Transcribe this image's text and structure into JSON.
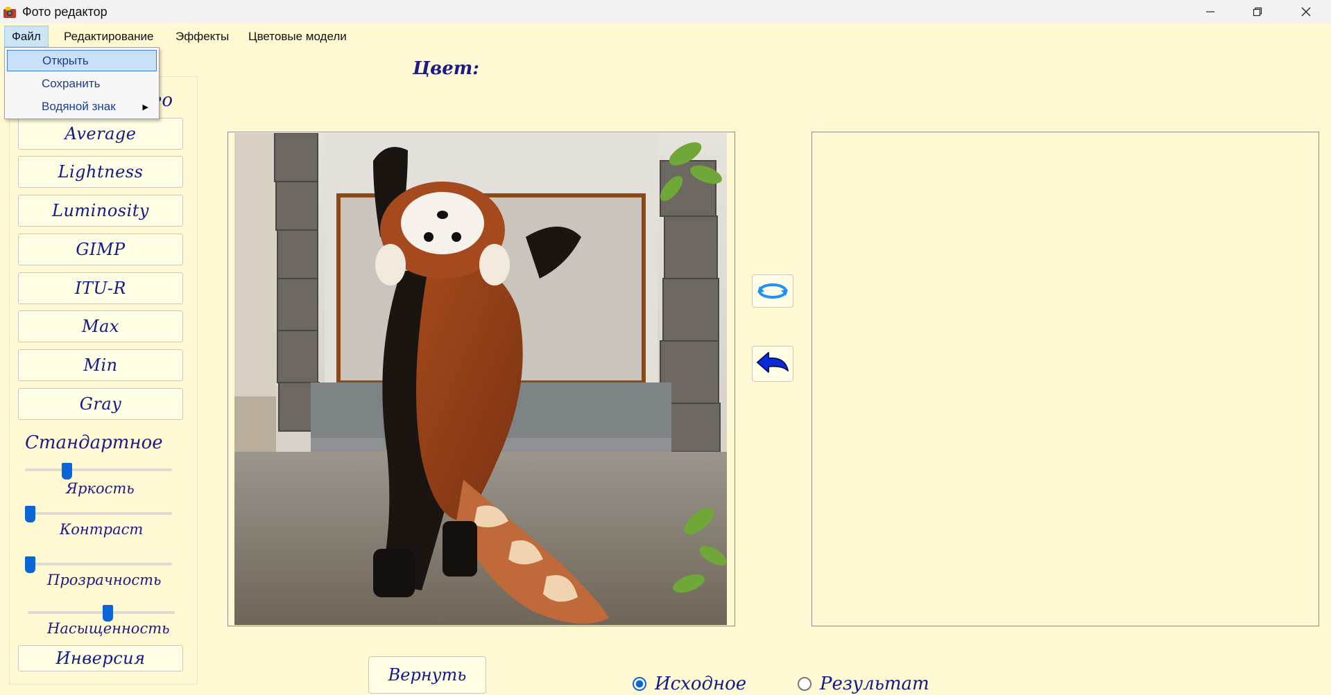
{
  "window": {
    "title": "Фото редактор",
    "controls": {
      "minimize": "minimize-icon",
      "maximize": "restore-window-icon",
      "close": "close-icon"
    }
  },
  "menu": {
    "items": [
      {
        "label": "Файл",
        "open": true
      },
      {
        "label": "Редактирование"
      },
      {
        "label": "Эффекты"
      },
      {
        "label": "Цветовые модели"
      }
    ],
    "file_dropdown": [
      {
        "label": "Открыть",
        "highlighted": true
      },
      {
        "label": "Сохранить"
      },
      {
        "label": "Водяной знак",
        "has_submenu": true
      }
    ]
  },
  "left_panel": {
    "heading_tail": "ео",
    "gray_buttons": [
      "Average",
      "Lightness",
      "Luminosity",
      "GIMP",
      "ITU-R",
      "Max",
      "Min",
      "Gray"
    ],
    "standard_title": "Стандартное",
    "sliders": [
      {
        "label": "Яркость",
        "value": 0.27
      },
      {
        "label": "Контраст",
        "value": 0.0
      },
      {
        "label": "Прозрачность",
        "value": 0.0
      },
      {
        "label": "Насыщенность",
        "value": 0.55
      }
    ],
    "invert_button": "Инверсия"
  },
  "color_label": "Цвет:",
  "source_image": "red-panda-photo",
  "action_buttons": {
    "rotate": "rotate-arrows-icon",
    "undo": "back-arrow-icon"
  },
  "restore_button": "Вернуть",
  "view_mode": {
    "options": [
      {
        "label": "Исходное",
        "checked": true
      },
      {
        "label": "Результат",
        "checked": false
      }
    ]
  },
  "colors": {
    "background": "#fff9d4",
    "accent": "#0a66d6",
    "text_accent": "#1a1a8a"
  }
}
